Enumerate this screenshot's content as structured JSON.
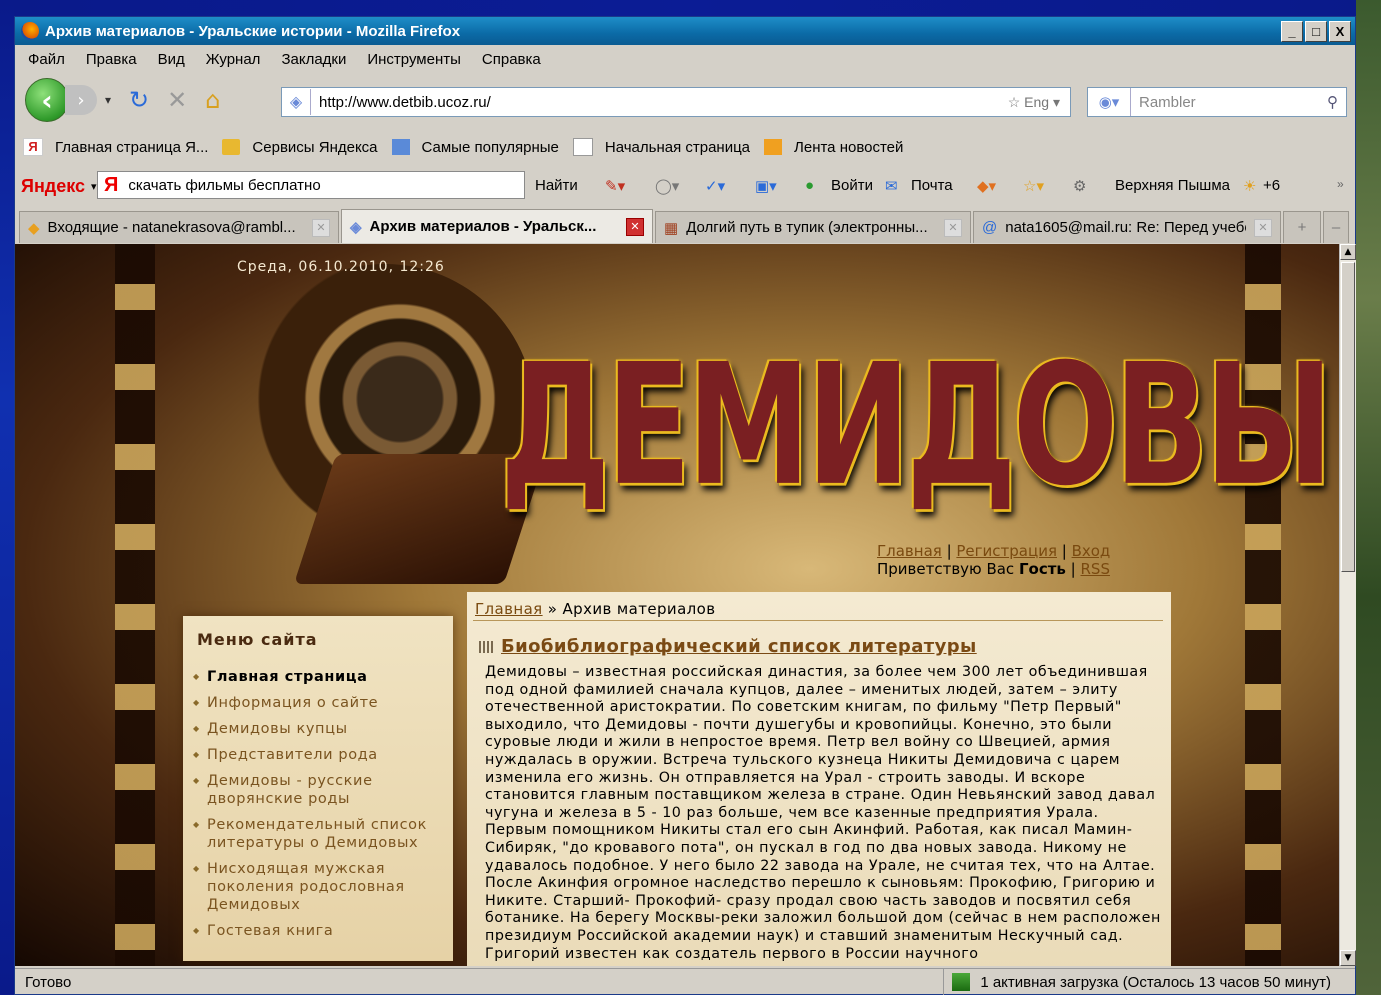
{
  "window": {
    "title": "Архив материалов - Уральские истории - Mozilla Firefox",
    "buttons": [
      "_",
      "□",
      "X"
    ]
  },
  "menu": [
    "Файл",
    "Правка",
    "Вид",
    "Журнал",
    "Закладки",
    "Инструменты",
    "Справка"
  ],
  "nav": {
    "url": "http://www.detbib.ucoz.ru/",
    "search_engine": "Rambler",
    "url_tail": "☆ Eng ▾"
  },
  "bookmarks": [
    {
      "label": "Главная страница Я...",
      "icon": "yandex-icon",
      "color": "#d02020"
    },
    {
      "label": "Сервисы Яндекса",
      "icon": "folder-icon",
      "color": "#e8b830"
    },
    {
      "label": "Самые популярные",
      "icon": "popular-icon",
      "color": "#5a8ad8"
    },
    {
      "label": "Начальная страница",
      "icon": "page-icon",
      "color": "#ffffff"
    },
    {
      "label": "Лента новостей",
      "icon": "rss-icon",
      "color": "#f0a020"
    }
  ],
  "yandex_bar": {
    "logo": "Яндекс",
    "query": "скачать фильмы бесплатно",
    "find": "Найти",
    "login": "Войти",
    "mail": "Почта",
    "city": "Верхняя Пышма",
    "weather": "+6"
  },
  "tabs": [
    {
      "label": "Входящие - natanekrasova@rambl...",
      "active": false
    },
    {
      "label": "Архив материалов - Уральск...",
      "active": true
    },
    {
      "label": "Долгий путь в тупик (электронны...",
      "active": false
    },
    {
      "label": "nata1605@mail.ru: Re: Перед учебо...",
      "active": false
    }
  ],
  "site": {
    "datetime": "Среда, 06.10.2010, 12:26",
    "banner_title": "ДЕМИДОВЫ",
    "topnav": {
      "home": "Главная",
      "register": "Регистрация",
      "login": "Вход",
      "greeting": "Приветствую Вас",
      "user": "Гость",
      "rss": "RSS"
    },
    "menu_title": "Меню сайта",
    "menu_items": [
      "Главная страница",
      "Информация о сайте",
      "Демидовы купцы",
      "Представители рода",
      "Демидовы - русские дворянские роды",
      "Рекомендательный список литературы о Демидовых",
      "Нисходящая мужская поколения родословная Демидовых",
      "Гостевая книга"
    ],
    "breadcrumb_home": "Главная",
    "breadcrumb_sep": "»",
    "breadcrumb_current": "Архив материалов",
    "article_title": "Биобиблиографический список литературы",
    "article_text": "Демидовы – известная российская династия, за более чем 300 лет объединившая под одной фамилией сначала купцов, далее – именитых людей, затем – элиту отечественной аристократии. По советским книгам, по фильму \"Петр Первый\" выходило, что Демидовы - почти душегубы и кровопийцы. Конечно, это были суровые люди и жили в непростое время. Петр вел войну со Швецией, армия нуждалась в оружии. Встреча тульского кузнеца Никиты Демидовича с царем изменила его жизнь. Он отправляется на Урал - строить заводы. И вскоре становится главным поставщиком железа в стране. Один Невьянский завод давал чугуна и железа в 5 - 10 раз больше, чем все казенные предприятия Урала. Первым помощником Никиты стал его сын Акинфий. Работая, как писал Мамин-Сибиряк, \"до кровавого пота\", он пускал в год по два новых завода. Никому не удавалось подобное. У него было 22 завода на Урале, не считая тех, что на Алтае. После Акинфия огромное наследство перешло к сыновьям: Прокофию, Григорию и Никите. Старший- Прокофий- сразу продал свою часть заводов и посвятил себя ботанике. На берегу Москвы-реки заложил большой дом (сейчас в нем расположен президиум Российской академии наук) и ставший знаменитым Нескучный сад. Григорий известен как создатель первого в России научного"
  },
  "status": {
    "left": "Готово",
    "download": "1 активная загрузка (Осталось 13 часов 50 минут)"
  }
}
